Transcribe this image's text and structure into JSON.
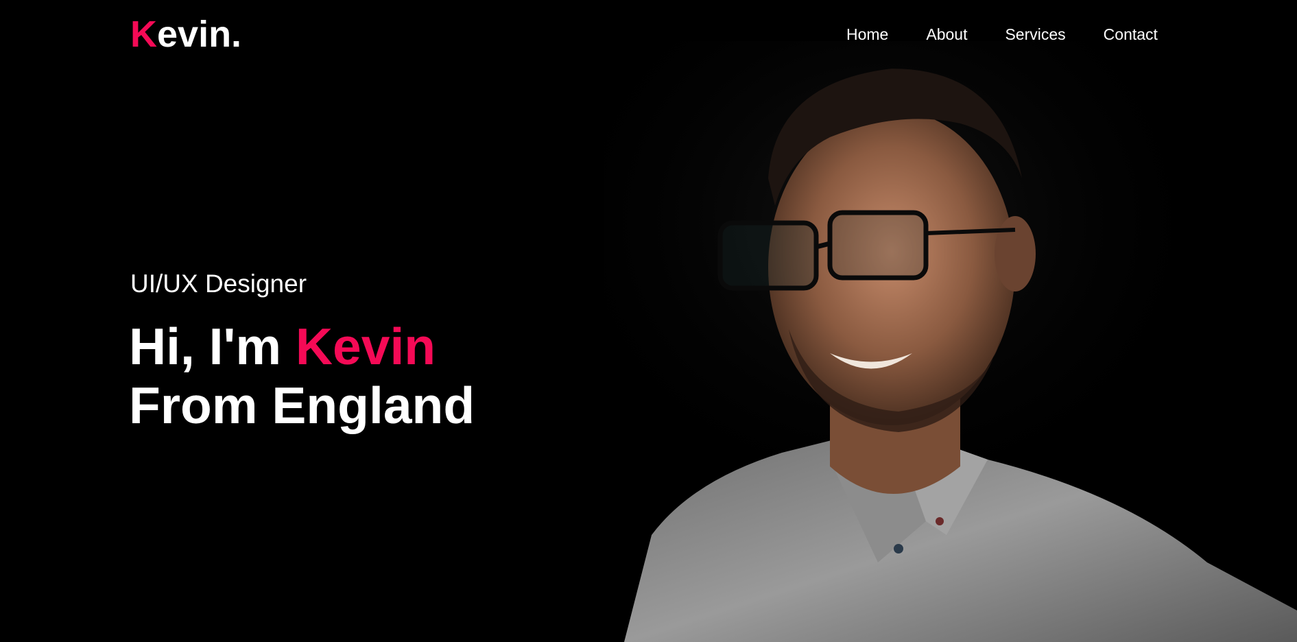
{
  "brand": {
    "logo_accent": "K",
    "logo_rest": "evin."
  },
  "nav": {
    "items": [
      {
        "label": "Home"
      },
      {
        "label": "About"
      },
      {
        "label": "Services"
      },
      {
        "label": "Contact"
      }
    ]
  },
  "hero": {
    "subtitle": "UI/UX Designer",
    "greeting": "Hi, I'm ",
    "name": "Kevin",
    "line2": "From England",
    "portrait_icon": "person-portrait"
  },
  "colors": {
    "accent": "#f50a56",
    "background": "#000000",
    "text": "#ffffff"
  }
}
